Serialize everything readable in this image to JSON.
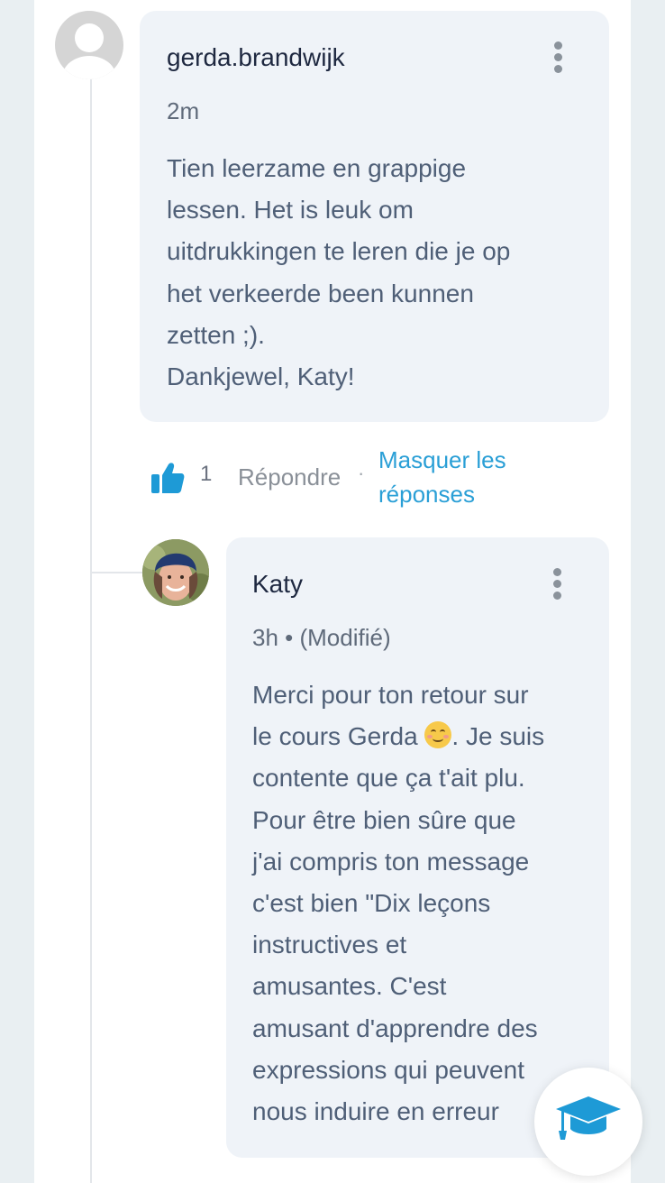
{
  "comment": {
    "author": "gerda.brandwijk",
    "time": "2m",
    "body_lines": [
      "Tien leerzame en grappige",
      "lessen. Het is leuk om",
      "uitdrukkingen te leren die je op",
      "het verkeerde been kunnen",
      "zetten ;).",
      "Dankjewel, Katy!"
    ],
    "menu_icon": "more-vertical-icon",
    "avatar_icon": "default-user-avatar"
  },
  "actions": {
    "like_icon": "thumbs-up-icon",
    "like_count": "1",
    "reply_label": "Répondre",
    "separator": "·",
    "hide_replies_line1": "Masquer les",
    "hide_replies_line2": "réponses"
  },
  "reply": {
    "author": "Katy",
    "meta": "3h • (Modifié)",
    "body_lines": [
      "Merci pour ton retour sur",
      "le cours Gerda",
      ". Je suis",
      "contente que ça t'ait plu.",
      "Pour être bien sûre que",
      "j'ai compris ton message",
      "c'est bien \"Dix leçons",
      "instructives et",
      "amusantes. C'est",
      "amusant d'apprendre des",
      "expressions qui peuvent",
      "nous induire en erreur"
    ],
    "emoji": "smiling-face-emoji",
    "menu_icon": "more-vertical-icon"
  },
  "fab": {
    "icon": "graduation-cap-icon"
  },
  "colors": {
    "link": "#2a9fd6",
    "bubble": "#eff3f8",
    "like": "#1e9ad6"
  }
}
